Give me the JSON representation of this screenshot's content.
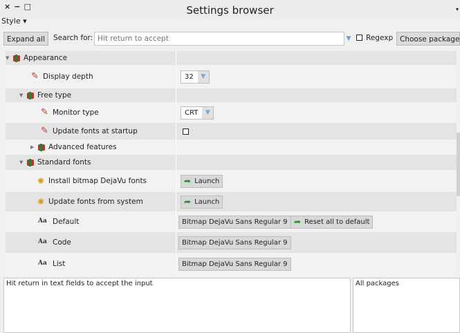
{
  "window": {
    "title": "Settings browser",
    "close": "×",
    "minimize": "−",
    "maximize": "□",
    "menu_arrow": "▾"
  },
  "menu": {
    "style": "Style ▾"
  },
  "toolbar": {
    "expand_all": "Expand all",
    "search_label": "Search for:",
    "search_placeholder": "Hit return to accept",
    "regexp_label": "Regexp",
    "choose_packages": "Choose packages"
  },
  "tree": [
    {
      "label": "Appearance"
    },
    {
      "label": "Display depth",
      "value": "32"
    },
    {
      "label": "Free type"
    },
    {
      "label": "Monitor type",
      "value": "CRT"
    },
    {
      "label": "Update fonts at startup"
    },
    {
      "label": "Advanced features"
    },
    {
      "label": "Standard fonts"
    },
    {
      "label": "Install bitmap DejaVu fonts",
      "button": "Launch"
    },
    {
      "label": "Update fonts from system",
      "button": "Launch"
    },
    {
      "label": "Default",
      "value": "Bitmap DejaVu Sans Regular 9",
      "extra": "Reset all to default"
    },
    {
      "label": "Code",
      "value": "Bitmap DejaVu Sans Regular 9"
    },
    {
      "label": "List",
      "value": "Bitmap DejaVu Sans Regular 9"
    }
  ],
  "aa_icon": "Aa",
  "status": {
    "help_text": "Hit return in text fields to accept the input",
    "packages": "All packages"
  }
}
